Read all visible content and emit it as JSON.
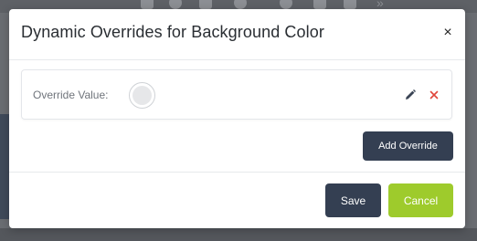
{
  "modal": {
    "title": "Dynamic Overrides for Background Color",
    "close_glyph": "×",
    "override": {
      "label": "Override Value:",
      "swatch_color": "#e6e7e9",
      "edit_icon": "pencil-icon",
      "delete_icon": "x-icon",
      "delete_color": "#e0463a"
    },
    "add_override_label": "Add Override",
    "save_label": "Save",
    "cancel_label": "Cancel"
  },
  "colors": {
    "primary_dark": "#343f52",
    "accent_green": "#9ecb2c",
    "overlay": "#6a6d72"
  }
}
